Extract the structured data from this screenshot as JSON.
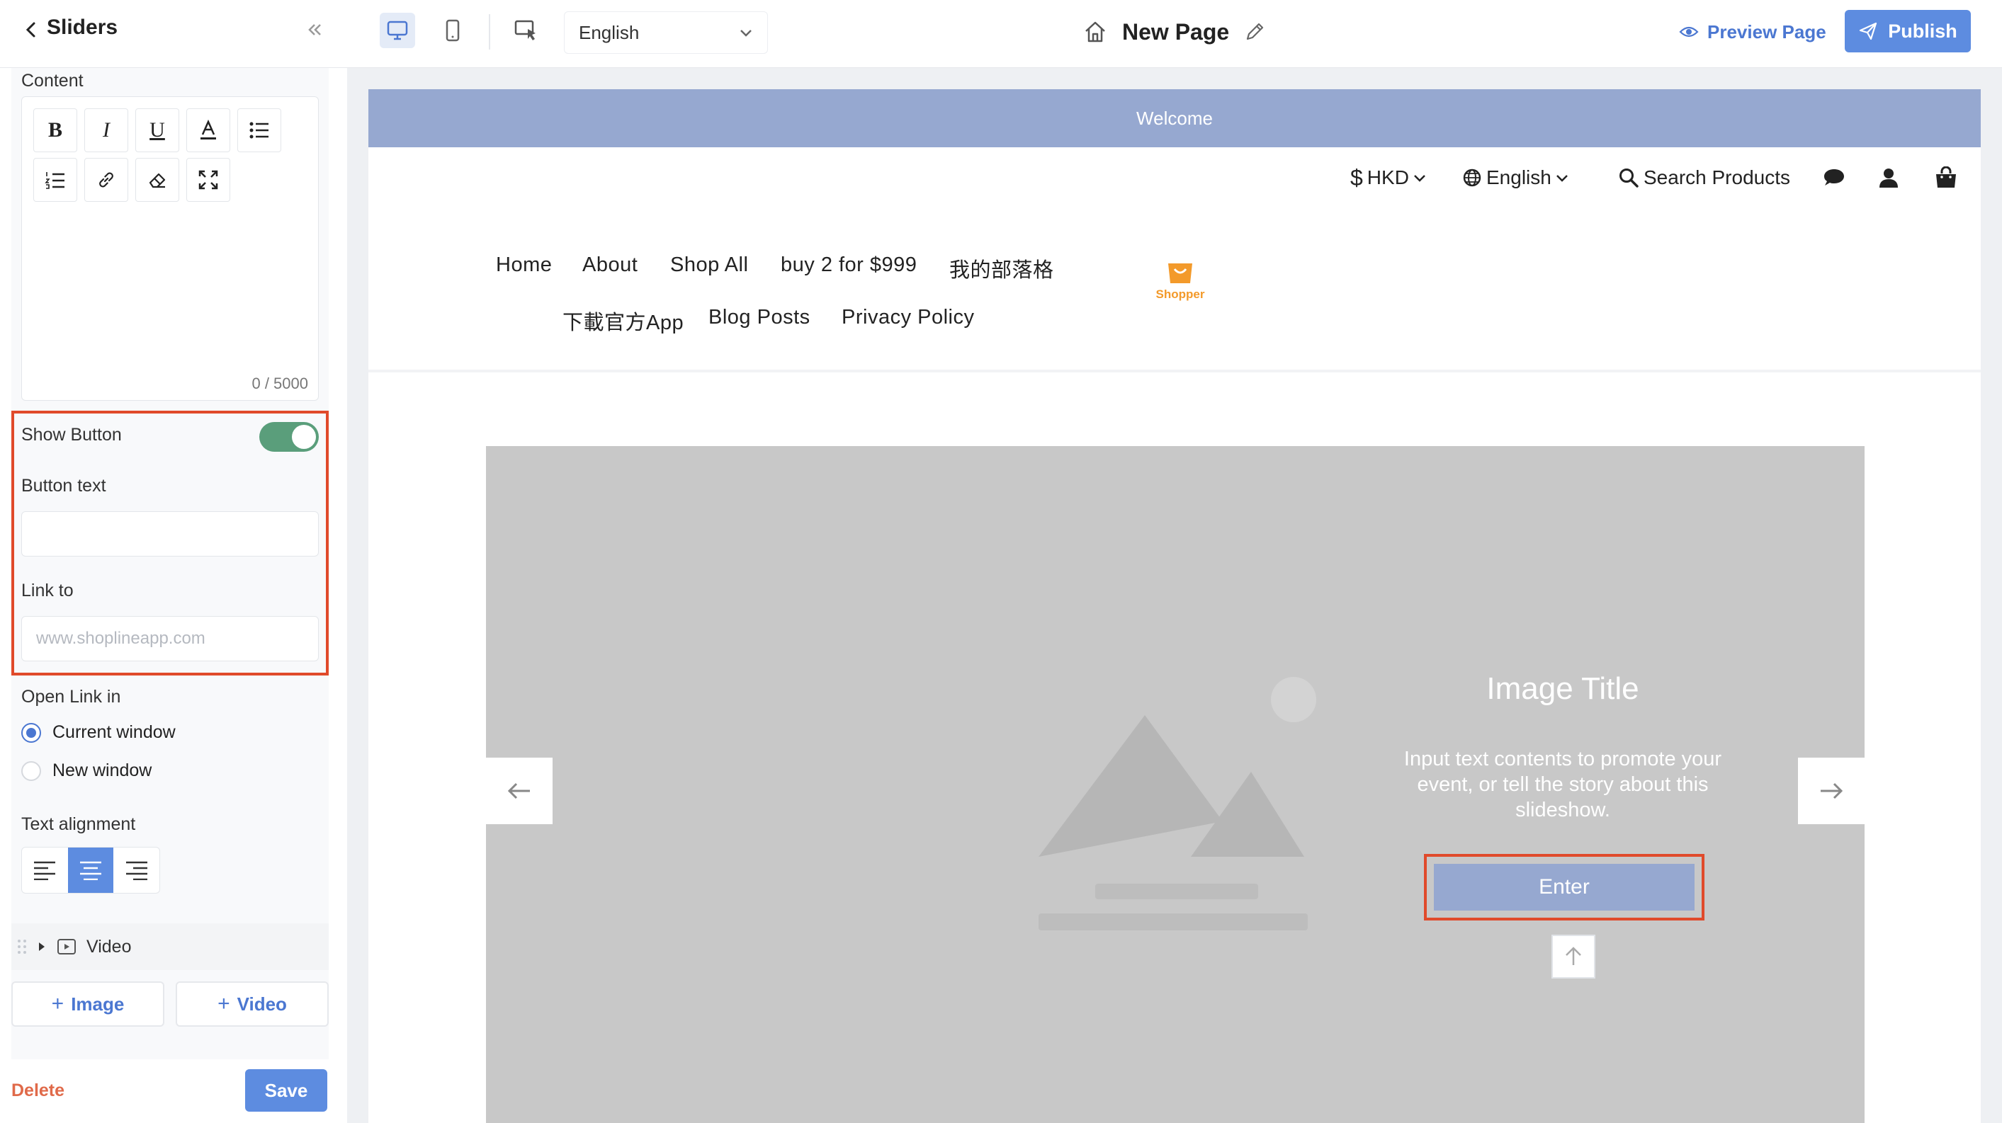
{
  "panel": {
    "title": "Sliders",
    "content_label": "Content",
    "char_counter": "0 / 5000",
    "show_button_label": "Show Button",
    "show_button_on": true,
    "button_text_label": "Button text",
    "button_text_value": "",
    "link_to_label": "Link to",
    "link_placeholder": "www.shoplineapp.com",
    "open_link_label": "Open Link in",
    "open_link_options": [
      "Current window",
      "New window"
    ],
    "open_link_selected": "Current window",
    "text_alignment_label": "Text alignment",
    "text_alignment_selected": "center",
    "video_item_label": "Video",
    "add_image_label": "Image",
    "add_video_label": "Video",
    "delete_label": "Delete",
    "save_label": "Save"
  },
  "toolbar": {
    "language": "English",
    "page_name": "New Page",
    "preview_label": "Preview Page",
    "publish_label": "Publish",
    "device_selected": "desktop"
  },
  "storefront": {
    "announcement": "Welcome",
    "currency": "HKD",
    "language": "English",
    "search_label": "Search Products",
    "nav_row1": [
      "Home",
      "About",
      "Shop All",
      "buy 2 for $999",
      "我的部落格"
    ],
    "nav_row2": [
      "下載官方App",
      "Blog Posts",
      "Privacy Policy"
    ],
    "logo_text": "Shopper",
    "slide_title": "Image Title",
    "slide_description": "Input text contents to promote your event, or tell the story about this slideshow.",
    "slide_button": "Enter"
  },
  "colors": {
    "accent": "#5d8ce0",
    "highlight": "#e04a2b",
    "toggle_on": "#5a9e7b",
    "announcement_bg": "#96a8d0",
    "slide_bg": "#c8c8c8"
  }
}
